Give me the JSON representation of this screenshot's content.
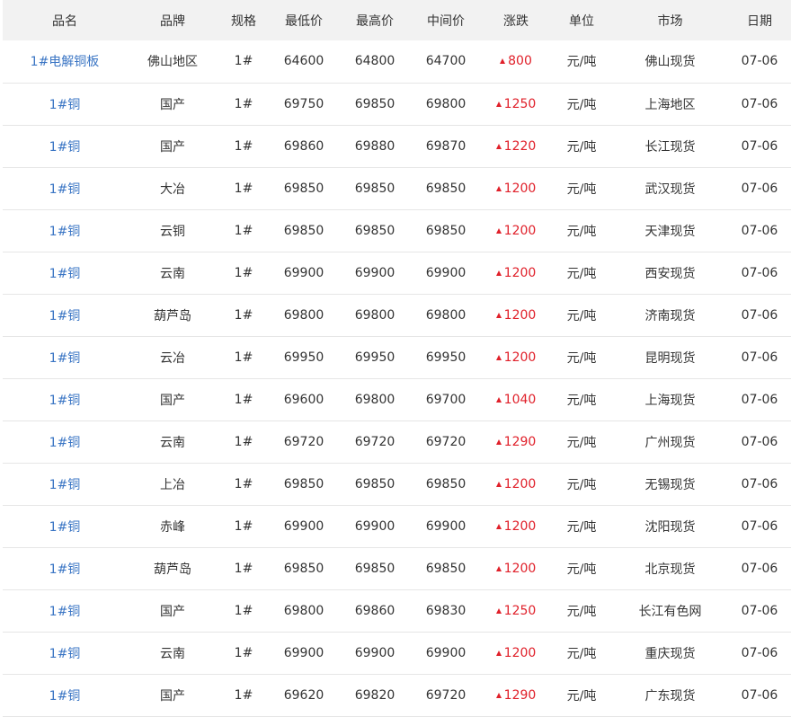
{
  "table": {
    "headers": [
      "品名",
      "品牌",
      "规格",
      "最低价",
      "最高价",
      "中间价",
      "涨跌",
      "单位",
      "市场",
      "日期"
    ],
    "rows": [
      {
        "product": "1#电解铜板",
        "brand": "佛山地区",
        "spec": "1#",
        "low": "64600",
        "high": "64800",
        "mid": "64700",
        "change": "800",
        "change_dir": "up",
        "unit": "元/吨",
        "market": "佛山现货",
        "date": "07-06"
      },
      {
        "product": "1#铜",
        "brand": "国产",
        "spec": "1#",
        "low": "69750",
        "high": "69850",
        "mid": "69800",
        "change": "1250",
        "change_dir": "up",
        "unit": "元/吨",
        "market": "上海地区",
        "date": "07-06"
      },
      {
        "product": "1#铜",
        "brand": "国产",
        "spec": "1#",
        "low": "69860",
        "high": "69880",
        "mid": "69870",
        "change": "1220",
        "change_dir": "up",
        "unit": "元/吨",
        "market": "长江现货",
        "date": "07-06"
      },
      {
        "product": "1#铜",
        "brand": "大冶",
        "spec": "1#",
        "low": "69850",
        "high": "69850",
        "mid": "69850",
        "change": "1200",
        "change_dir": "up",
        "unit": "元/吨",
        "market": "武汉现货",
        "date": "07-06"
      },
      {
        "product": "1#铜",
        "brand": "云铜",
        "spec": "1#",
        "low": "69850",
        "high": "69850",
        "mid": "69850",
        "change": "1200",
        "change_dir": "up",
        "unit": "元/吨",
        "market": "天津现货",
        "date": "07-06"
      },
      {
        "product": "1#铜",
        "brand": "云南",
        "spec": "1#",
        "low": "69900",
        "high": "69900",
        "mid": "69900",
        "change": "1200",
        "change_dir": "up",
        "unit": "元/吨",
        "market": "西安现货",
        "date": "07-06"
      },
      {
        "product": "1#铜",
        "brand": "葫芦岛",
        "spec": "1#",
        "low": "69800",
        "high": "69800",
        "mid": "69800",
        "change": "1200",
        "change_dir": "up",
        "unit": "元/吨",
        "market": "济南现货",
        "date": "07-06"
      },
      {
        "product": "1#铜",
        "brand": "云冶",
        "spec": "1#",
        "low": "69950",
        "high": "69950",
        "mid": "69950",
        "change": "1200",
        "change_dir": "up",
        "unit": "元/吨",
        "market": "昆明现货",
        "date": "07-06"
      },
      {
        "product": "1#铜",
        "brand": "国产",
        "spec": "1#",
        "low": "69600",
        "high": "69800",
        "mid": "69700",
        "change": "1040",
        "change_dir": "up",
        "unit": "元/吨",
        "market": "上海现货",
        "date": "07-06"
      },
      {
        "product": "1#铜",
        "brand": "云南",
        "spec": "1#",
        "low": "69720",
        "high": "69720",
        "mid": "69720",
        "change": "1290",
        "change_dir": "up",
        "unit": "元/吨",
        "market": "广州现货",
        "date": "07-06"
      },
      {
        "product": "1#铜",
        "brand": "上冶",
        "spec": "1#",
        "low": "69850",
        "high": "69850",
        "mid": "69850",
        "change": "1200",
        "change_dir": "up",
        "unit": "元/吨",
        "market": "无锡现货",
        "date": "07-06"
      },
      {
        "product": "1#铜",
        "brand": "赤峰",
        "spec": "1#",
        "low": "69900",
        "high": "69900",
        "mid": "69900",
        "change": "1200",
        "change_dir": "up",
        "unit": "元/吨",
        "market": "沈阳现货",
        "date": "07-06"
      },
      {
        "product": "1#铜",
        "brand": "葫芦岛",
        "spec": "1#",
        "low": "69850",
        "high": "69850",
        "mid": "69850",
        "change": "1200",
        "change_dir": "up",
        "unit": "元/吨",
        "market": "北京现货",
        "date": "07-06"
      },
      {
        "product": "1#铜",
        "brand": "国产",
        "spec": "1#",
        "low": "69800",
        "high": "69860",
        "mid": "69830",
        "change": "1250",
        "change_dir": "up",
        "unit": "元/吨",
        "market": "长江有色网",
        "date": "07-06"
      },
      {
        "product": "1#铜",
        "brand": "云南",
        "spec": "1#",
        "low": "69900",
        "high": "69900",
        "mid": "69900",
        "change": "1200",
        "change_dir": "up",
        "unit": "元/吨",
        "market": "重庆现货",
        "date": "07-06"
      },
      {
        "product": "1#铜",
        "brand": "国产",
        "spec": "1#",
        "low": "69620",
        "high": "69820",
        "mid": "69720",
        "change": "1290",
        "change_dir": "up",
        "unit": "元/吨",
        "market": "广东现货",
        "date": "07-06"
      }
    ]
  },
  "colors": {
    "link": "#3a75c4",
    "up": "#e0202a",
    "header_bg": "#f2f2f2",
    "row_border": "#e6e6e6",
    "text": "#333333"
  },
  "icons": {
    "change_up": "up-arrow-icon"
  }
}
